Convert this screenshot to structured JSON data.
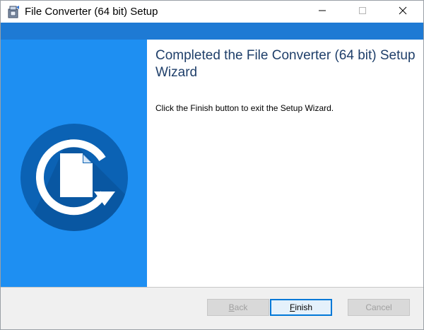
{
  "window": {
    "title": "File Converter (64 bit) Setup"
  },
  "wizard": {
    "heading": "Completed the File Converter (64 bit) Setup Wizard",
    "message": "Click the Finish button to exit the Setup Wizard."
  },
  "buttons": {
    "back": {
      "mnemonic": "B",
      "rest": "ack"
    },
    "finish": {
      "mnemonic": "F",
      "rest": "inish"
    },
    "cancel": {
      "label": "Cancel"
    }
  },
  "colors": {
    "accent_strip": "#1e7ad4",
    "left_panel": "#1e8ff2",
    "logo_disc": "#0b62b4",
    "heading_text": "#1f3f6a",
    "default_button_border": "#0078d7"
  },
  "icons": {
    "app": "installer-package-icon",
    "logo": "file-converter-logo-icon",
    "minimize": "minimize-icon",
    "maximize": "maximize-icon",
    "close": "close-icon"
  }
}
